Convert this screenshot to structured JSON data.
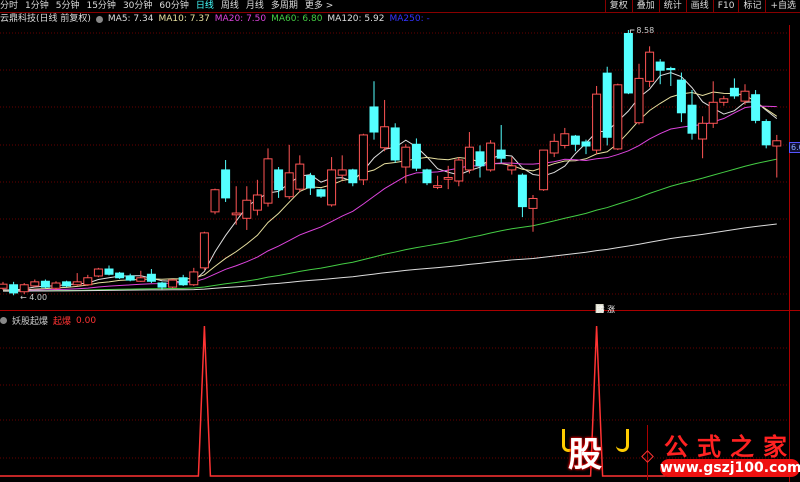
{
  "menu": {
    "periods": [
      "分时",
      "1分钟",
      "5分钟",
      "15分钟",
      "30分钟",
      "60分钟",
      "日线",
      "周线",
      "月线",
      "多周期",
      "更多 >"
    ],
    "active_index": 6,
    "right_buttons": [
      "复权",
      "叠加",
      "统计",
      "画线",
      "F10",
      "标记",
      "+自选"
    ]
  },
  "title": {
    "stock": "云鼎科技(日线 前复权)",
    "ma5": "MA5: 7.34",
    "ma10": "MA10: 7.37",
    "ma20": "MA20: 7.50",
    "ma60": "MA60: 6.80",
    "ma120": "MA120: 5.92",
    "ma250": "MA250: -"
  },
  "colors": {
    "up": "#ff5555",
    "down": "#54ffff",
    "ma5": "#dddddd",
    "ma10": "#e8e0a0",
    "ma20": "#dd44dd",
    "ma60": "#44cc44",
    "ma120": "#dddddd",
    "grid": "#660000",
    "indicator": "#ff3333"
  },
  "annotations": {
    "high_label": "8.58",
    "low_label": "4.00",
    "right_price": "6.0",
    "signal_label": "腾 涨"
  },
  "indicator": {
    "name": "妖股起爆",
    "field": "起爆",
    "value": "0.00",
    "signals": [
      19,
      56
    ]
  },
  "watermark": {
    "char": "股",
    "brand": "公式之家",
    "url": "www.gszj100.com"
  },
  "chart_data": {
    "type": "candlestick",
    "price_range": [
      4.0,
      8.58
    ],
    "candles": [
      [
        4.15,
        4.22,
        4.26,
        4.12
      ],
      [
        4.21,
        4.07,
        4.26,
        4.03
      ],
      [
        4.09,
        4.21,
        4.24,
        4.05
      ],
      [
        4.19,
        4.26,
        4.3,
        4.17
      ],
      [
        4.27,
        4.17,
        4.3,
        4.15
      ],
      [
        4.15,
        4.24,
        4.27,
        4.12
      ],
      [
        4.26,
        4.19,
        4.28,
        4.17
      ],
      [
        4.21,
        4.26,
        4.41,
        4.19
      ],
      [
        4.21,
        4.33,
        4.38,
        4.19
      ],
      [
        4.36,
        4.48,
        4.5,
        4.34
      ],
      [
        4.48,
        4.39,
        4.54,
        4.37
      ],
      [
        4.41,
        4.33,
        4.43,
        4.31
      ],
      [
        4.36,
        4.29,
        4.4,
        4.27
      ],
      [
        4.27,
        4.33,
        4.45,
        4.26
      ],
      [
        4.39,
        4.27,
        4.48,
        4.24
      ],
      [
        4.24,
        4.17,
        4.26,
        4.13
      ],
      [
        4.17,
        4.29,
        4.31,
        4.15
      ],
      [
        4.33,
        4.21,
        4.38,
        4.19
      ],
      [
        4.21,
        4.43,
        4.5,
        4.19
      ],
      [
        4.5,
        5.1,
        5.12,
        4.46
      ],
      [
        5.46,
        5.84,
        5.86,
        5.42
      ],
      [
        6.18,
        5.7,
        6.35,
        5.63
      ],
      [
        5.41,
        5.44,
        5.9,
        5.24
      ],
      [
        5.35,
        5.66,
        5.9,
        5.15
      ],
      [
        5.49,
        5.75,
        6.01,
        5.4
      ],
      [
        5.61,
        6.37,
        6.55,
        5.55
      ],
      [
        6.18,
        5.84,
        6.23,
        5.7
      ],
      [
        5.72,
        6.13,
        6.61,
        5.68
      ],
      [
        5.85,
        6.28,
        6.43,
        5.8
      ],
      [
        6.08,
        5.87,
        6.13,
        5.75
      ],
      [
        5.84,
        5.73,
        5.86,
        5.7
      ],
      [
        5.58,
        6.18,
        6.4,
        5.55
      ],
      [
        6.09,
        6.18,
        6.43,
        6.0
      ],
      [
        6.18,
        5.96,
        6.2,
        5.9
      ],
      [
        6.01,
        6.78,
        6.8,
        5.92
      ],
      [
        7.26,
        6.83,
        7.7,
        6.7
      ],
      [
        6.56,
        6.92,
        7.38,
        6.5
      ],
      [
        6.9,
        6.35,
        6.98,
        6.3
      ],
      [
        6.23,
        6.57,
        6.62,
        5.95
      ],
      [
        6.62,
        6.21,
        6.72,
        6.16
      ],
      [
        6.18,
        5.96,
        6.2,
        5.92
      ],
      [
        5.88,
        5.91,
        6.08,
        5.85
      ],
      [
        6.02,
        6.05,
        6.25,
        5.85
      ],
      [
        5.99,
        6.35,
        6.4,
        5.9
      ],
      [
        6.18,
        6.57,
        6.83,
        6.12
      ],
      [
        6.49,
        6.25,
        6.6,
        6.05
      ],
      [
        6.18,
        6.64,
        6.69,
        6.15
      ],
      [
        6.52,
        6.38,
        6.95,
        6.3
      ],
      [
        6.18,
        6.25,
        6.4,
        6.1
      ],
      [
        6.09,
        5.55,
        6.12,
        5.37
      ],
      [
        5.52,
        5.69,
        5.75,
        5.12
      ],
      [
        5.84,
        6.52,
        6.52,
        5.82
      ],
      [
        6.47,
        6.67,
        6.8,
        6.4
      ],
      [
        6.6,
        6.8,
        6.9,
        6.55
      ],
      [
        6.76,
        6.62,
        6.78,
        6.5
      ],
      [
        6.66,
        6.59,
        6.7,
        6.45
      ],
      [
        6.52,
        7.48,
        7.62,
        6.45
      ],
      [
        7.84,
        6.74,
        7.95,
        6.6
      ],
      [
        6.54,
        7.64,
        7.66,
        6.52
      ],
      [
        8.52,
        7.5,
        8.58,
        7.48
      ],
      [
        6.99,
        7.75,
        8.0,
        6.96
      ],
      [
        7.7,
        8.2,
        8.3,
        7.6
      ],
      [
        8.03,
        7.89,
        8.08,
        7.65
      ],
      [
        7.92,
        7.9,
        7.95,
        7.62
      ],
      [
        7.72,
        7.16,
        7.85,
        7.0
      ],
      [
        7.29,
        6.81,
        7.55,
        6.7
      ],
      [
        6.71,
        6.98,
        7.1,
        6.38
      ],
      [
        6.98,
        7.34,
        7.7,
        6.9
      ],
      [
        7.34,
        7.4,
        7.45,
        7.28
      ],
      [
        7.58,
        7.45,
        7.75,
        7.4
      ],
      [
        7.36,
        7.53,
        7.65,
        7.3
      ],
      [
        7.47,
        7.03,
        7.55,
        6.98
      ],
      [
        7.01,
        6.61,
        7.05,
        6.55
      ],
      [
        6.59,
        6.68,
        6.78,
        6.05
      ]
    ],
    "prior_history_price": 4.1
  }
}
